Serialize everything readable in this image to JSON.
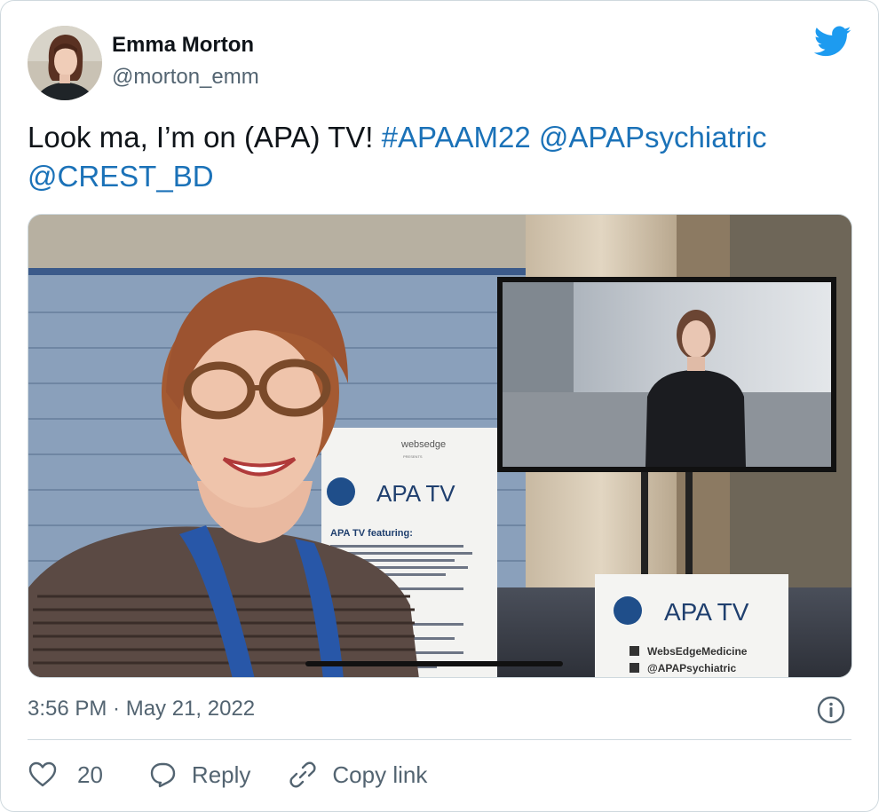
{
  "author": {
    "name": "Emma Morton",
    "handle": "@morton_emm"
  },
  "tweet": {
    "text": "Look ma, I’m on (APA) TV!",
    "hashtag": "#APAAM22",
    "mention1": "@APAPsychiatric",
    "mention2": "@CREST_BD"
  },
  "media": {
    "sign_brand": "websedge",
    "sign_presents": "PRESENTS",
    "apa_tv_label": "APA TV",
    "featuring": "APA TV featuring:",
    "youtube_handle": "WebsEdgeMedicine",
    "twitter_handle": "@APAPsychiatric"
  },
  "timestamp": "3:56 PM · May 21, 2022",
  "actions": {
    "like_count": "20",
    "reply_label": "Reply",
    "copy_label": "Copy link"
  },
  "colors": {
    "link": "#1b72b8",
    "twitter_blue": "#1d9bf0",
    "text_secondary": "#536471"
  },
  "icons": [
    "twitter-bird-icon",
    "info-icon",
    "heart-icon",
    "reply-icon",
    "link-icon"
  ]
}
